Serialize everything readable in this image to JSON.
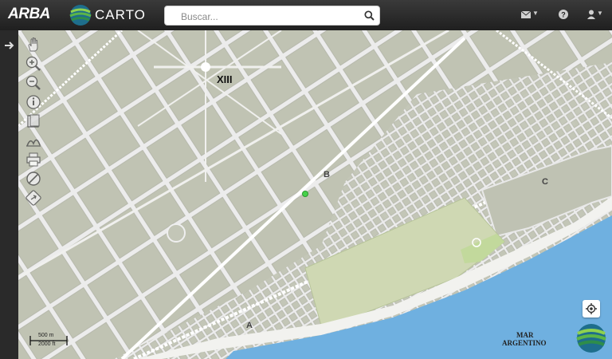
{
  "header": {
    "brand_primary": "ARBA",
    "brand_secondary": "CARTO",
    "search_placeholder": "Buscar..."
  },
  "map": {
    "labels": {
      "sector_xiii": "XIII",
      "sector_b": "B",
      "sector_c": "C",
      "sector_a": "A",
      "sea_line1": "MAR",
      "sea_line2": "ARGENTINO"
    },
    "scale": {
      "top": "500 m",
      "bottom": "2000 ft"
    }
  },
  "colors": {
    "land": "#b9bcad",
    "block": "#c3c6b7",
    "street": "#ececec",
    "park": "#cfd8b3",
    "sea": "#6fb0e0",
    "beach": "#f2f2ef",
    "rail": "#ffffff",
    "marker": "#46d24a"
  },
  "icons": [
    "hand-icon",
    "zoom-in-icon",
    "zoom-out-icon",
    "info-icon",
    "layers-icon",
    "measure-icon",
    "print-icon",
    "no-entry-icon",
    "share-icon",
    "locate-icon",
    "envelope-icon",
    "help-icon",
    "user-icon"
  ]
}
